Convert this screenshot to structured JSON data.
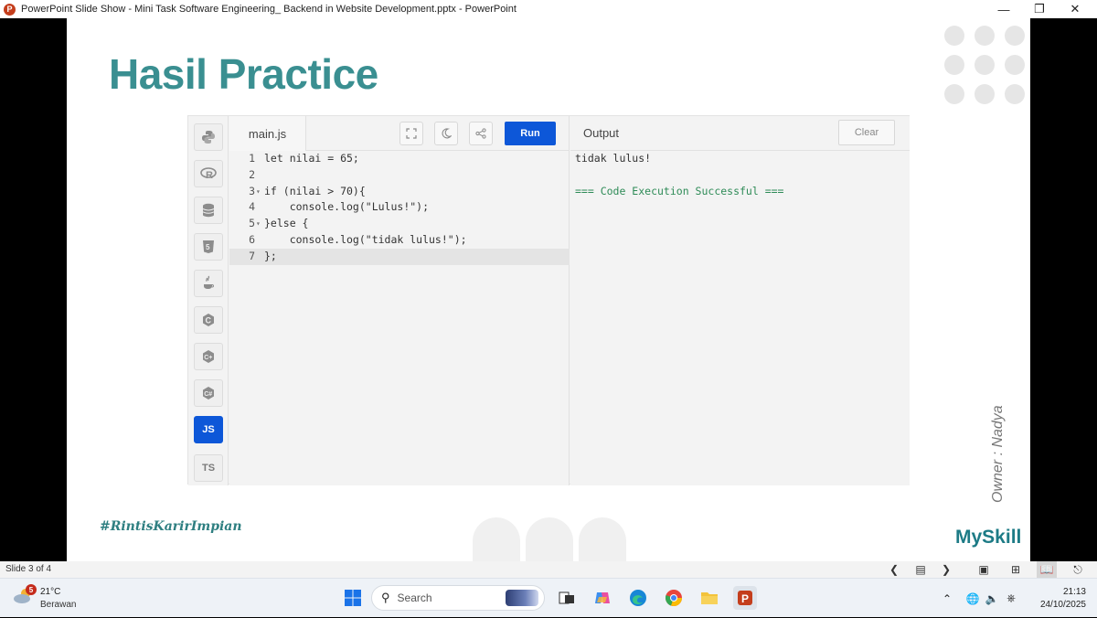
{
  "window": {
    "app_icon": "P",
    "title": "PowerPoint Slide Show  -  Mini Task Software Engineering_ Backend in Website Development.pptx - PowerPoint",
    "controls": [
      "minimize-icon",
      "restore-icon",
      "close-icon"
    ]
  },
  "slide": {
    "title": "Hasil Practice",
    "hashtag": "#RintisKarirImpian",
    "brand": "MySkill",
    "owner": "Owner : Nadya"
  },
  "editor": {
    "languages": [
      {
        "label": "",
        "icon": "python-icon"
      },
      {
        "label": "",
        "icon": "r-icon"
      },
      {
        "label": "",
        "icon": "database-icon"
      },
      {
        "label": "",
        "icon": "html5-icon"
      },
      {
        "label": "",
        "icon": "java-icon"
      },
      {
        "label": "",
        "icon": "c-icon"
      },
      {
        "label": "",
        "icon": "cpp-icon"
      },
      {
        "label": "",
        "icon": "csharp-icon"
      },
      {
        "label": "JS",
        "icon": "javascript-icon",
        "active": true
      },
      {
        "label": "TS",
        "icon": "typescript-icon"
      }
    ],
    "file_tab": "main.js",
    "run_label": "Run",
    "output_title": "Output",
    "clear_label": "Clear",
    "code": [
      {
        "num": "1",
        "fold": "",
        "text": "let nilai = 65;"
      },
      {
        "num": "2",
        "fold": "",
        "text": ""
      },
      {
        "num": "3",
        "fold": "▾",
        "text": "if (nilai > 70){"
      },
      {
        "num": "4",
        "fold": "",
        "text": "    console.log(\"Lulus!\");"
      },
      {
        "num": "5",
        "fold": "▾",
        "text": "}else {"
      },
      {
        "num": "6",
        "fold": "",
        "text": "    console.log(\"tidak lulus!\");"
      },
      {
        "num": "7",
        "fold": "",
        "text": "};",
        "current": true
      }
    ],
    "output": [
      {
        "text": "tidak lulus!",
        "kind": "result"
      },
      {
        "text": "",
        "kind": "result"
      },
      {
        "text": "=== Code Execution Successful ===",
        "kind": "success"
      }
    ]
  },
  "statusbar": {
    "slide_indicator": "Slide 3 of 4"
  },
  "taskbar": {
    "weather_badge": "5",
    "temperature": "21°C",
    "weather_desc": "Berawan",
    "search_placeholder": "Search",
    "time": "21:13",
    "date": "24/10/2025"
  },
  "colors": {
    "title": "#3a8f91",
    "run_button": "#0d57d8",
    "success_text": "#2e8b57",
    "powerpoint": "#c43e1c"
  }
}
